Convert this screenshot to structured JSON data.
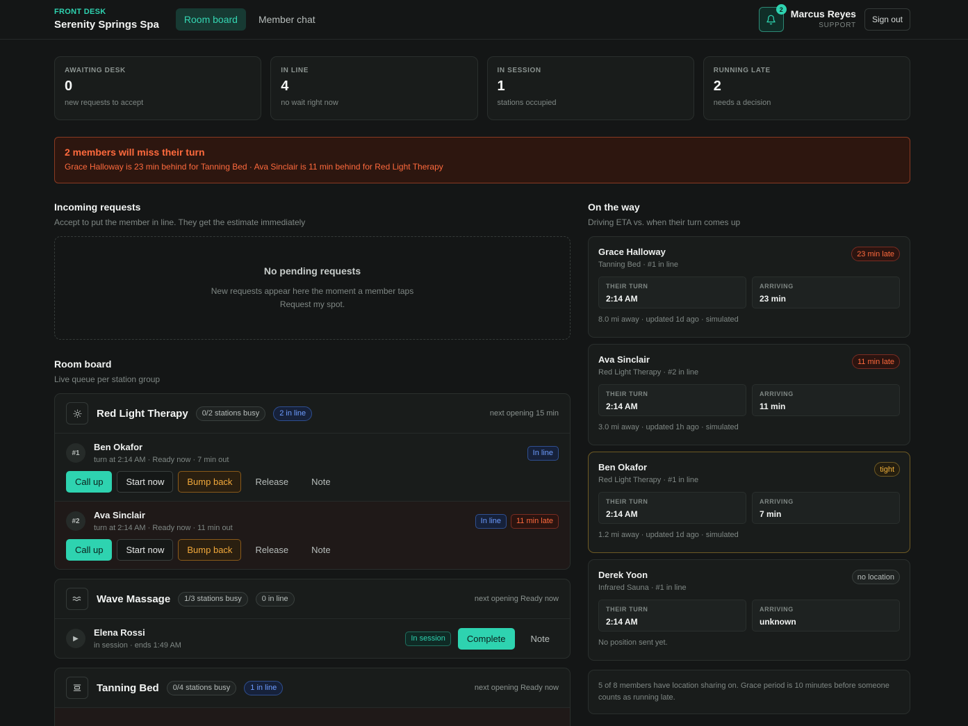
{
  "header": {
    "eyebrow": "FRONT DESK",
    "spa_name": "Serenity Springs Spa",
    "tabs": [
      {
        "label": "Room board",
        "active": true
      },
      {
        "label": "Member chat",
        "active": false
      }
    ],
    "notification_count": "2",
    "user_name": "Marcus Reyes",
    "user_role": "SUPPORT",
    "sign_out": "Sign out"
  },
  "stats": [
    {
      "label": "AWAITING DESK",
      "value": "0",
      "sub": "new requests to accept"
    },
    {
      "label": "IN LINE",
      "value": "4",
      "sub": "no wait right now"
    },
    {
      "label": "IN SESSION",
      "value": "1",
      "sub": "stations occupied"
    },
    {
      "label": "RUNNING LATE",
      "value": "2",
      "sub": "needs a decision"
    }
  ],
  "alert": {
    "title": "2 members will miss their turn",
    "detail": "Grace Halloway is 23 min behind for Tanning Bed · Ava Sinclair is 11 min behind for Red Light Therapy"
  },
  "incoming": {
    "title": "Incoming requests",
    "subtitle": "Accept to put the member in line. They get the estimate immediately",
    "empty_title": "No pending requests",
    "empty_text": "New requests appear here the moment a member taps Request my spot."
  },
  "room_board": {
    "title": "Room board",
    "subtitle": "Live queue per station group",
    "groups": [
      {
        "name": "Red Light Therapy",
        "busy": "0/2 stations busy",
        "in_line": "2 in line",
        "next": "next opening 15 min",
        "rows": [
          {
            "pos": "#1",
            "name": "Ben Okafor",
            "meta": "turn at 2:14 AM · Ready now · 7 min out",
            "status": "In line"
          },
          {
            "pos": "#2",
            "name": "Ava Sinclair",
            "meta": "turn at 2:14 AM · Ready now · 11 min out",
            "status": "In line",
            "late": "11 min late"
          }
        ]
      },
      {
        "name": "Wave Massage",
        "busy": "1/3 stations busy",
        "in_line": "0 in line",
        "next": "next opening Ready now",
        "session": {
          "name": "Elena Rossi",
          "meta": "in session · ends 1:49 AM",
          "status": "In session"
        }
      },
      {
        "name": "Tanning Bed",
        "busy": "0/4 stations busy",
        "in_line": "1 in line",
        "next": "next opening Ready now"
      }
    ],
    "actions": {
      "call_up": "Call up",
      "start_now": "Start now",
      "bump_back": "Bump back",
      "release": "Release",
      "note": "Note",
      "complete": "Complete"
    }
  },
  "on_the_way": {
    "title": "On the way",
    "subtitle": "Driving ETA vs. when their turn comes up",
    "turn_label": "THEIR TURN",
    "arriving_label": "ARRIVING",
    "members": [
      {
        "name": "Grace Halloway",
        "sub": "Tanning Bed · #1 in line",
        "badge": "23 min late",
        "turn": "2:14 AM",
        "arriving": "23 min",
        "foot": "8.0 mi away · updated 1d ago · simulated"
      },
      {
        "name": "Ava Sinclair",
        "sub": "Red Light Therapy · #2 in line",
        "badge": "11 min late",
        "turn": "2:14 AM",
        "arriving": "11 min",
        "foot": "3.0 mi away · updated 1h ago · simulated"
      },
      {
        "name": "Ben Okafor",
        "sub": "Red Light Therapy · #1 in line",
        "badge": "tight",
        "turn": "2:14 AM",
        "arriving": "7 min",
        "foot": "1.2 mi away · updated 1d ago · simulated"
      },
      {
        "name": "Derek Yoon",
        "sub": "Infrared Sauna · #1 in line",
        "badge": "no location",
        "turn": "2:14 AM",
        "arriving": "unknown",
        "foot": "No position sent yet."
      }
    ],
    "note": "5 of 8 members have location sharing on. Grace period is 10 minutes before someone counts as running late."
  },
  "colors": {
    "accent": "#2ed3b0",
    "late": "#ff6a3d",
    "info": "#6d9cff",
    "warn": "#f2a93b",
    "background": "#141616"
  }
}
